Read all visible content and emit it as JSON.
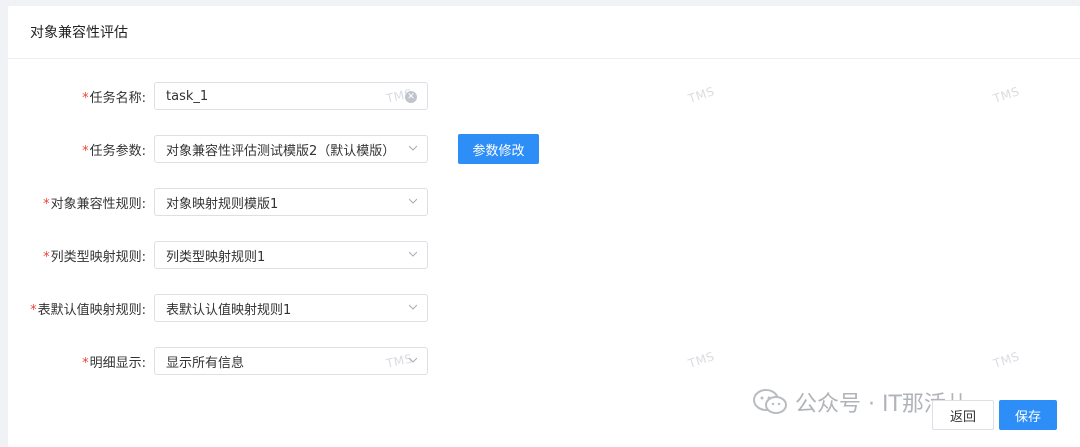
{
  "panel": {
    "title": "对象兼容性评估"
  },
  "form": {
    "task_name": {
      "label": "任务名称:",
      "value": "task_1"
    },
    "task_params": {
      "label": "任务参数:",
      "value": "对象兼容性评估测试模版2（默认模版）",
      "modify_button": "参数修改"
    },
    "object_compat_rule": {
      "label": "对象兼容性规则:",
      "value": "对象映射规则模版1"
    },
    "column_type_rule": {
      "label": "列类型映射规则:",
      "value": "列类型映射规则1"
    },
    "table_default_rule": {
      "label": "表默认值映射规则:",
      "value": "表默认认值映射规则1"
    },
    "detail_display": {
      "label": "明细显示:",
      "value": "显示所有信息"
    },
    "required_mark": "*"
  },
  "watermark": {
    "text": "TMS"
  },
  "actions": {
    "back": "返回",
    "save": "保存"
  },
  "overlay": {
    "text": "公众号 · IT那活儿"
  },
  "colors": {
    "primary": "#2e8ef7",
    "required": "#f04134",
    "border": "#dcdfe6"
  }
}
